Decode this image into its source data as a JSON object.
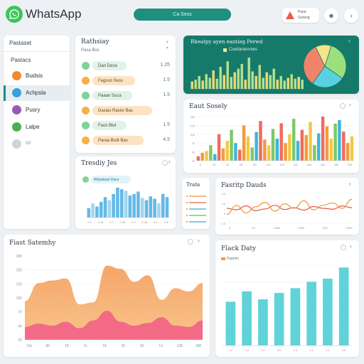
{
  "app": {
    "title": "WhatsApp",
    "search_label": "Ca Sess"
  },
  "profile": {
    "name_line1": "Pane",
    "name_line2": "Goreng"
  },
  "sidebar": {
    "header": "Pastaset",
    "section": "Pastacs",
    "items": [
      {
        "label": "Budsis",
        "color": "#f08a2c"
      },
      {
        "label": "Achpsla",
        "color": "#3aa0e0"
      },
      {
        "label": "Pusry",
        "color": "#9b59b6"
      },
      {
        "label": "Lalpe",
        "color": "#4caf50"
      },
      {
        "label": "Isl",
        "color": "#d0d4d8"
      }
    ]
  },
  "chats": {
    "title": "Rathsiay",
    "subtitle": "Pasa Bos",
    "rows": [
      {
        "text": "Dan Desa",
        "value": "1.25",
        "bubble": "#dff3ea"
      },
      {
        "text": "Fagsoo Sess",
        "value": "1.5",
        "bubble": "#fde3c3"
      },
      {
        "text": "Paaan Suca",
        "value": "1.5",
        "bubble": "#dff3ea"
      },
      {
        "text": "Dasias Rasisr Bas",
        "value": "",
        "bubble": "#fde3c3"
      },
      {
        "text": "Faos Bkd",
        "value": "1.5",
        "bubble": "#dff3ea"
      },
      {
        "text": "Paraa Bsdt Bas",
        "value": "4.5",
        "bubble": "#fde3c3"
      }
    ]
  },
  "teal_panel": {
    "title": "Rheatpy ayen eantieg Perwd",
    "legend": "Coeitanienmes"
  },
  "teal_chart": {
    "type": "bar",
    "values": [
      8,
      10,
      14,
      9,
      16,
      12,
      20,
      11,
      24,
      15,
      30,
      13,
      18,
      22,
      27,
      10,
      34,
      19,
      14,
      26,
      12,
      18,
      15,
      22,
      10,
      14,
      9,
      12,
      16,
      11,
      13,
      10
    ],
    "pie": [
      {
        "value": 30,
        "color": "#9be07a"
      },
      {
        "value": 25,
        "color": "#5ad1e0"
      },
      {
        "value": 33,
        "color": "#f2836b"
      },
      {
        "value": 12,
        "color": "#f4e38a"
      }
    ]
  },
  "edu_chart": {
    "title": "Eaut Sosely",
    "type": "bar",
    "yticks": [
      "150",
      "125",
      "100",
      "75",
      "50",
      "25"
    ],
    "xticks": [
      "0",
      "20",
      "40",
      "60",
      "80",
      "100",
      "120",
      "140",
      "160",
      "180",
      "200",
      "222"
    ],
    "values": [
      10,
      18,
      22,
      35,
      15,
      60,
      28,
      45,
      70,
      40,
      25,
      80,
      55,
      30,
      65,
      90,
      48,
      35,
      72,
      50,
      85,
      40,
      60,
      95,
      45,
      70,
      58,
      88,
      35,
      62,
      100,
      78,
      50,
      84,
      92,
      66,
      40,
      55
    ],
    "colors": [
      "#f06a5e",
      "#f39a3c",
      "#f5c842",
      "#7cc86a",
      "#3fb6d9"
    ]
  },
  "trending": {
    "title": "Tresdiy Jes",
    "legend": "Wiaratsan Dacs",
    "values": [
      12,
      18,
      14,
      20,
      26,
      22,
      30,
      38,
      36,
      34,
      28,
      30,
      33,
      25,
      22,
      27,
      24,
      18,
      30,
      26
    ],
    "xticks": [
      "0.1",
      "0.15",
      "0.2",
      "0.25",
      "0.3",
      "0.35",
      "0.4",
      "0.5"
    ]
  },
  "mini_lines": {
    "title": "Trata"
  },
  "line_chart": {
    "title": "Fasritp Dauds",
    "type": "line",
    "xticks": [
      "0",
      "10",
      "Beta",
      "1500",
      "200",
      "1000"
    ],
    "yticks": [
      "12",
      "10",
      "0",
      "0.5"
    ],
    "orange": [
      30,
      60,
      35,
      55,
      70,
      40,
      65,
      50,
      75,
      45,
      60,
      68,
      50,
      80
    ],
    "red": [
      50,
      45,
      58,
      42,
      48,
      60,
      46,
      52,
      44,
      56,
      50,
      47,
      58,
      52
    ]
  },
  "area_chart": {
    "title": "Fiast Satemhy",
    "type": "area",
    "yticks": [
      "180",
      "150",
      "120",
      "100",
      "70",
      "40",
      "20"
    ],
    "xticks": [
      "1Ss",
      "80",
      "18",
      "2c",
      "18",
      "30",
      "90",
      "12",
      "138",
      "186"
    ],
    "orange": [
      60,
      88,
      92,
      95,
      55,
      58,
      115,
      110,
      90,
      100,
      62,
      80,
      75,
      88
    ],
    "pink": [
      20,
      25,
      22,
      28,
      18,
      30,
      45,
      28,
      22,
      26,
      35,
      22,
      20,
      30
    ]
  },
  "bar_chart": {
    "title": "Flack Daty",
    "legend": "Papeim",
    "type": "bar",
    "xticks": [
      "1.0",
      "1.0",
      "2.0",
      "3.0",
      "1.0",
      "0.1",
      "1.0",
      "2.0"
    ],
    "values": [
      55,
      68,
      58,
      66,
      72,
      80,
      84,
      98
    ]
  }
}
